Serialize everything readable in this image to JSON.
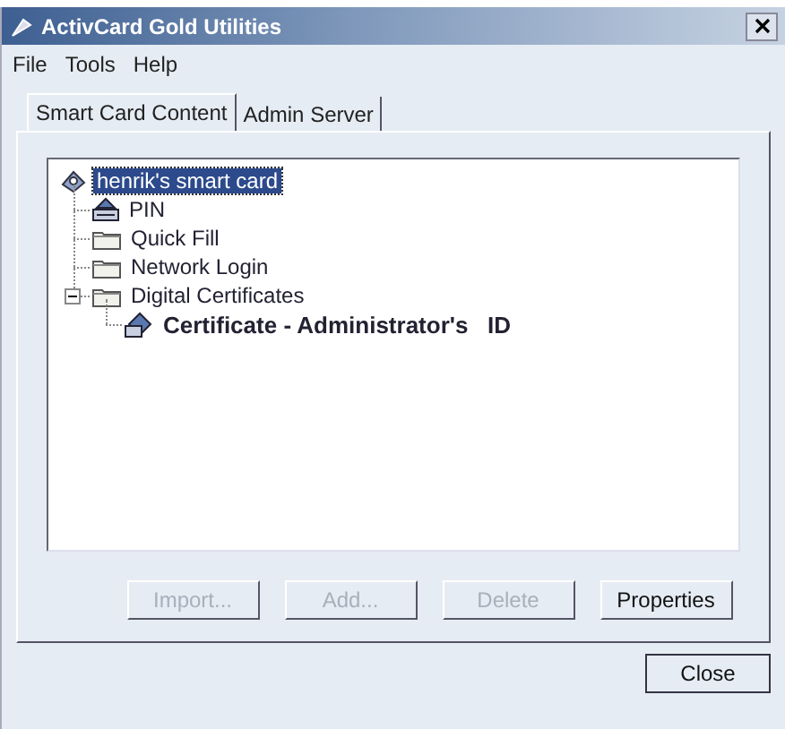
{
  "window": {
    "title": "ActivCard Gold Utilities"
  },
  "menu": [
    {
      "label": "File"
    },
    {
      "label": "Tools"
    },
    {
      "label": "Help"
    }
  ],
  "tabs": [
    {
      "label": "Smart Card Content",
      "selected": true
    },
    {
      "label": "Admin Server",
      "selected": false
    }
  ],
  "tree": [
    {
      "label": "henrik's smart card",
      "kind": "card",
      "selected": true,
      "bold": false,
      "children": [
        {
          "label": "PIN",
          "kind": "pin",
          "selected": false,
          "bold": false
        },
        {
          "label": "Quick Fill",
          "kind": "folder",
          "selected": false,
          "bold": false
        },
        {
          "label": "Network Login",
          "kind": "folder",
          "selected": false,
          "bold": false
        },
        {
          "label": "Digital Certificates",
          "kind": "folder",
          "selected": false,
          "bold": false,
          "expanded": true,
          "children": [
            {
              "label": "Certificate - Administrator's   ID",
              "kind": "cert",
              "selected": false,
              "bold": true
            }
          ]
        }
      ]
    }
  ],
  "buttons": [
    {
      "label": "Import...",
      "disabled": true
    },
    {
      "label": "Add...",
      "disabled": true
    },
    {
      "label": "Delete",
      "disabled": true
    },
    {
      "label": "Properties",
      "disabled": false
    }
  ],
  "close_button": {
    "label": "Close"
  }
}
